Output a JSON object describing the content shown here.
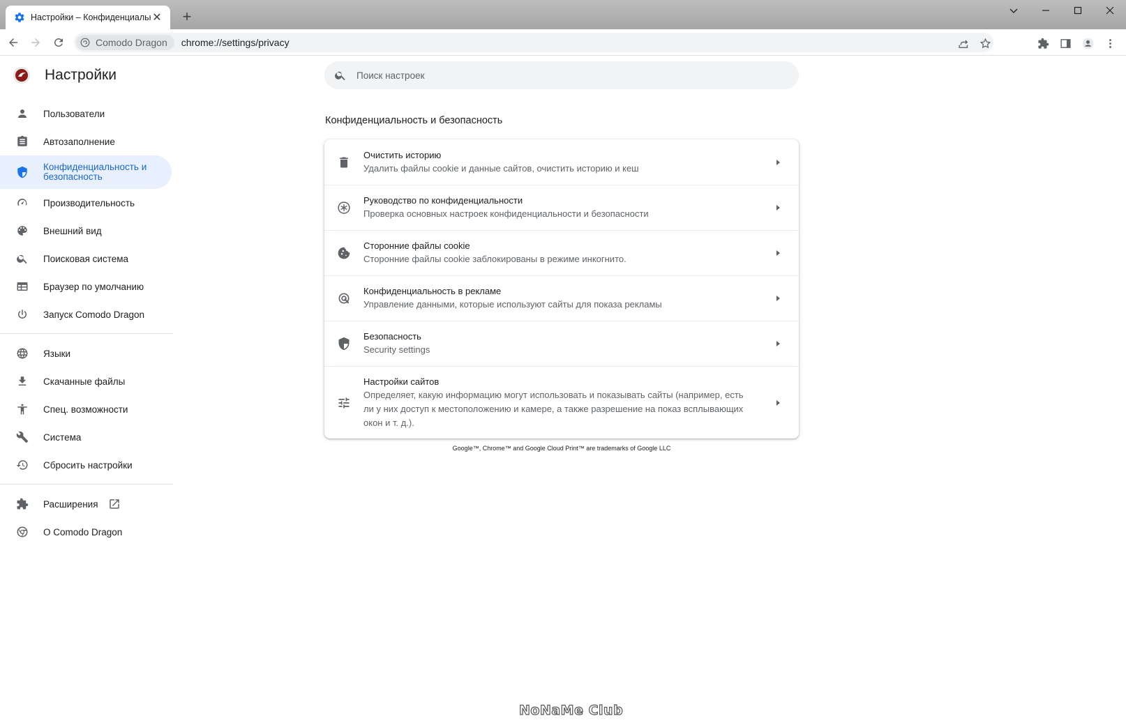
{
  "tab": {
    "title": "Настройки – Конфиденциальность и безопасность",
    "icon": "gear-icon"
  },
  "window": {
    "controls": [
      "chevron-down-icon",
      "minimize-icon",
      "maximize-icon",
      "close-icon"
    ]
  },
  "toolbar": {
    "site_chip": "Comodo Dragon",
    "url": "chrome://settings/privacy"
  },
  "header": {
    "title": "Настройки"
  },
  "search": {
    "placeholder": "Поиск настроек"
  },
  "sidebar": {
    "items": [
      {
        "label": "Пользователи",
        "icon": "person-icon"
      },
      {
        "label": "Автозаполнение",
        "icon": "clipboard-icon"
      },
      {
        "label": "Конфиденциальность и безопасность",
        "icon": "shield-icon",
        "active": true
      },
      {
        "label": "Производительность",
        "icon": "speedometer-icon"
      },
      {
        "label": "Внешний вид",
        "icon": "palette-icon"
      },
      {
        "label": "Поисковая система",
        "icon": "search-icon"
      },
      {
        "label": "Браузер по умолчанию",
        "icon": "browser-icon"
      },
      {
        "label": "Запуск Comodo Dragon",
        "icon": "power-icon"
      }
    ],
    "items2": [
      {
        "label": "Языки",
        "icon": "globe-icon"
      },
      {
        "label": "Скачанные файлы",
        "icon": "download-icon"
      },
      {
        "label": "Спец. возможности",
        "icon": "accessibility-icon"
      },
      {
        "label": "Система",
        "icon": "wrench-icon"
      },
      {
        "label": "Сбросить настройки",
        "icon": "history-icon"
      }
    ],
    "items3": [
      {
        "label": "Расширения",
        "icon": "puzzle-icon"
      },
      {
        "label": "О Comodo Dragon",
        "icon": "chrome-icon"
      }
    ]
  },
  "main": {
    "section_title": "Конфиденциальность и безопасность",
    "rows": [
      {
        "title": "Очистить историю",
        "subtitle": "Удалить файлы cookie и данные сайтов, очистить историю и кеш",
        "icon": "trash-icon"
      },
      {
        "title": "Руководство по конфиденциальности",
        "subtitle": "Проверка основных настроек конфиденциальности и безопасности",
        "icon": "privacy-guide-icon"
      },
      {
        "title": "Сторонние файлы cookie",
        "subtitle": "Сторонние файлы cookie заблокированы в режиме инкогнито.",
        "icon": "cookie-icon"
      },
      {
        "title": "Конфиденциальность в рекламе",
        "subtitle": "Управление данными, которые используют сайты для показа рекламы",
        "icon": "ad-privacy-icon"
      },
      {
        "title": "Безопасность",
        "subtitle": "Security settings",
        "icon": "security-shield-icon"
      },
      {
        "title": "Настройки сайтов",
        "subtitle": "Определяет, какую информацию могут использовать и показывать сайты (например, есть ли у них доступ к местоположению и камере, а также разрешение на показ всплывающих окон и т. д.).",
        "icon": "tune-icon"
      }
    ],
    "footer": "Google™, Chrome™ and Google Cloud Print™ are trademarks of Google LLC"
  },
  "watermark": "NoNaMe Club"
}
